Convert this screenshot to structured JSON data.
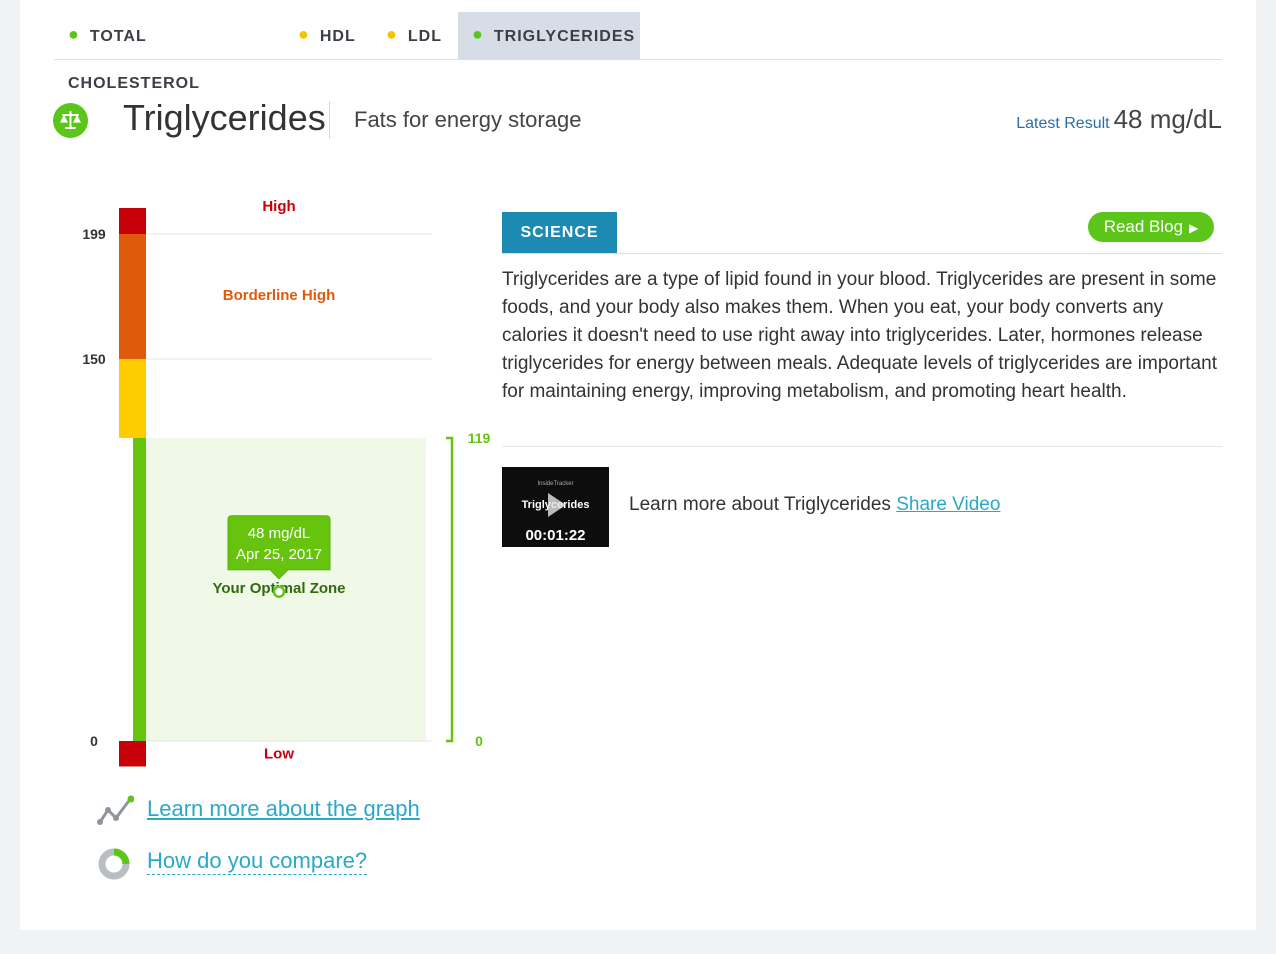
{
  "tabs": [
    {
      "label": "TOTAL CHOLESTEROL",
      "dot_color": "#5cc51a"
    },
    {
      "label": "HDL",
      "dot_color": "#f5c400"
    },
    {
      "label": "LDL",
      "dot_color": "#f5c400"
    },
    {
      "label": "TRIGLYCERIDES",
      "dot_color": "#5cc51a",
      "active": true
    }
  ],
  "header": {
    "icon": "balance-scale-icon",
    "title": "Triglycerides",
    "subtitle": "Fats for energy storage",
    "latest_label": "Latest Result",
    "latest_value": "48 mg/dL"
  },
  "chart_data": {
    "type": "range-gauge",
    "ticks": [
      "199",
      "150",
      "0"
    ],
    "zones": [
      {
        "label": "High",
        "from": 199,
        "to": 220,
        "color": "#c8000a"
      },
      {
        "label": "Borderline High",
        "from": 150,
        "to": 199,
        "color": "#e05a0c"
      },
      {
        "label": "",
        "from": 119,
        "to": 150,
        "color": "#fdcd00"
      },
      {
        "label": "Low",
        "from": -10,
        "to": 0,
        "color": "#c8000a"
      }
    ],
    "optimal_zone": {
      "from": 0,
      "to": 119,
      "color": "#66c40e",
      "fill": "#f0f9e8",
      "label": "Your Optimal Zone"
    },
    "optimal_ticks": [
      "119",
      "0"
    ],
    "result": {
      "value": 48,
      "value_label": "48 mg/dL",
      "date": "Apr 25, 2017"
    }
  },
  "links": {
    "graph": "Learn more about the graph",
    "compare": "How do you compare?"
  },
  "science": {
    "tab": "SCIENCE",
    "read_blog": "Read Blog",
    "text": "Triglycerides are a type of lipid found in your blood. Triglycerides are present in some foods, and your body also makes them. When you eat, your body converts any calories it doesn't need to use right away into triglycerides. Later, hormones release triglycerides for energy between meals. Adequate levels of triglycerides are important for maintaining energy, improving metabolism, and promoting heart health."
  },
  "video": {
    "brand": "InsideTracker",
    "thumb_title": "Triglycerides",
    "duration": "00:01:22",
    "text": "Learn more about Triglycerides",
    "share": "Share Video"
  }
}
